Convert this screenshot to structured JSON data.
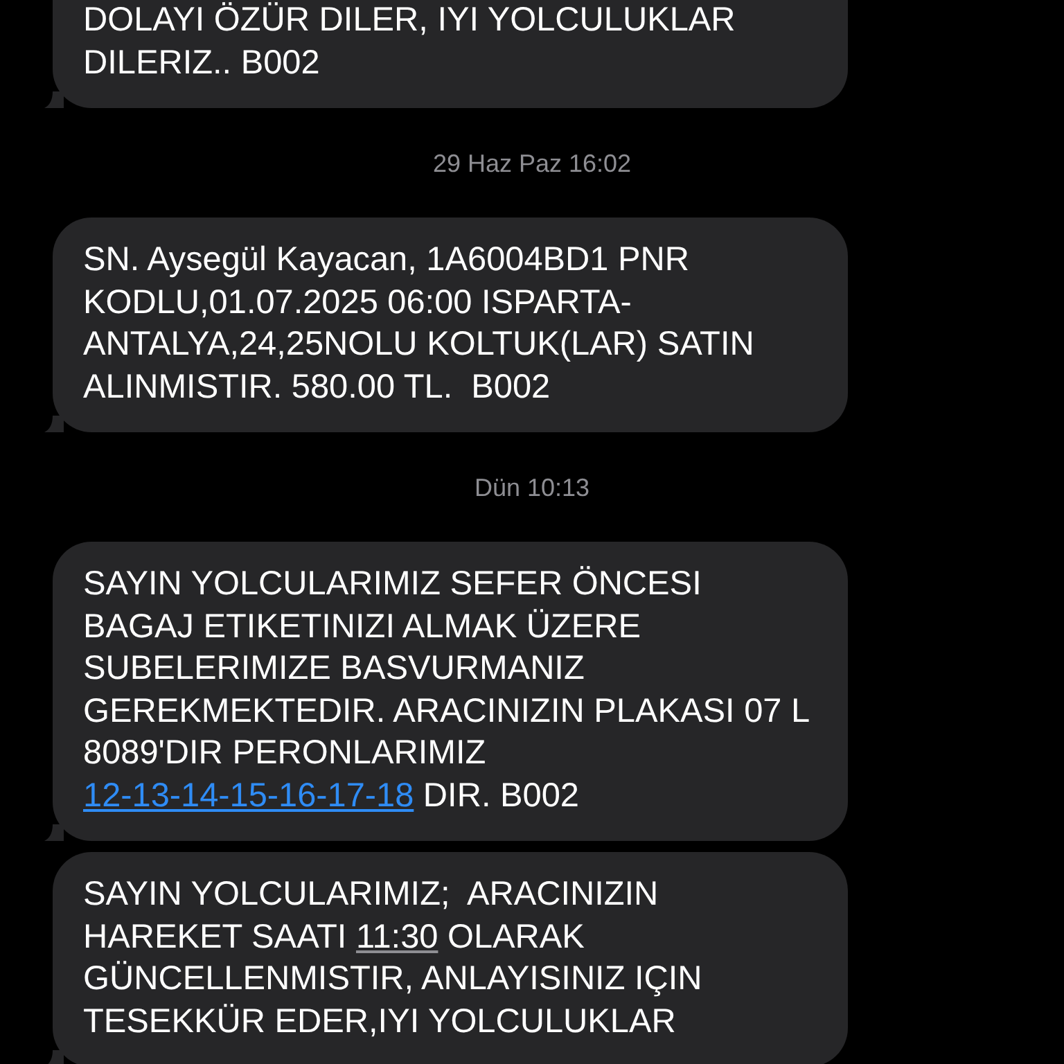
{
  "messages": [
    {
      "kind": "bubble",
      "parts": [
        {
          "kind": "plain",
          "text": "DOLAYI ÖZÜR DILER, IYI YOLCULUKLAR DILERIZ.. B002"
        }
      ]
    },
    {
      "kind": "timestamp",
      "text": "29 Haz Paz 16:02"
    },
    {
      "kind": "bubble",
      "parts": [
        {
          "kind": "plain",
          "text": "SN. Aysegül Kayacan, 1A6004BD1 PNR KODLU,01.07.2025 06:00 ISPARTA-ANTALYA,24,25NOLU KOLTUK(LAR) SATIN ALINMISTIR. 580.00 TL.  B002"
        }
      ]
    },
    {
      "kind": "timestamp",
      "text": "Dün 10:13"
    },
    {
      "kind": "bubble",
      "parts": [
        {
          "kind": "plain",
          "text": "SAYIN YOLCULARIMIZ SEFER ÖNCESI BAGAJ ETIKETINIZI ALMAK ÜZERE SUBELERIMIZE BASVURMANIZ GEREKMEKTEDIR. ARACINIZIN PLAKASI 07 L 8089'DIR PERONLARIMIZ "
        },
        {
          "kind": "link",
          "text": "12-13-14-15-16-17-18"
        },
        {
          "kind": "plain",
          "text": " DIR. B002"
        }
      ]
    },
    {
      "kind": "bubble",
      "parts": [
        {
          "kind": "plain",
          "text": "SAYIN YOLCULARIMIZ;  ARACINIZIN HAREKET SAATI "
        },
        {
          "kind": "time",
          "text": "11:30"
        },
        {
          "kind": "plain",
          "text": " OLARAK GÜNCELLENMISTIR, ANLAYISINIZ IÇIN TESEKKÜR EDER,IYI YOLCULUKLAR"
        }
      ]
    }
  ]
}
